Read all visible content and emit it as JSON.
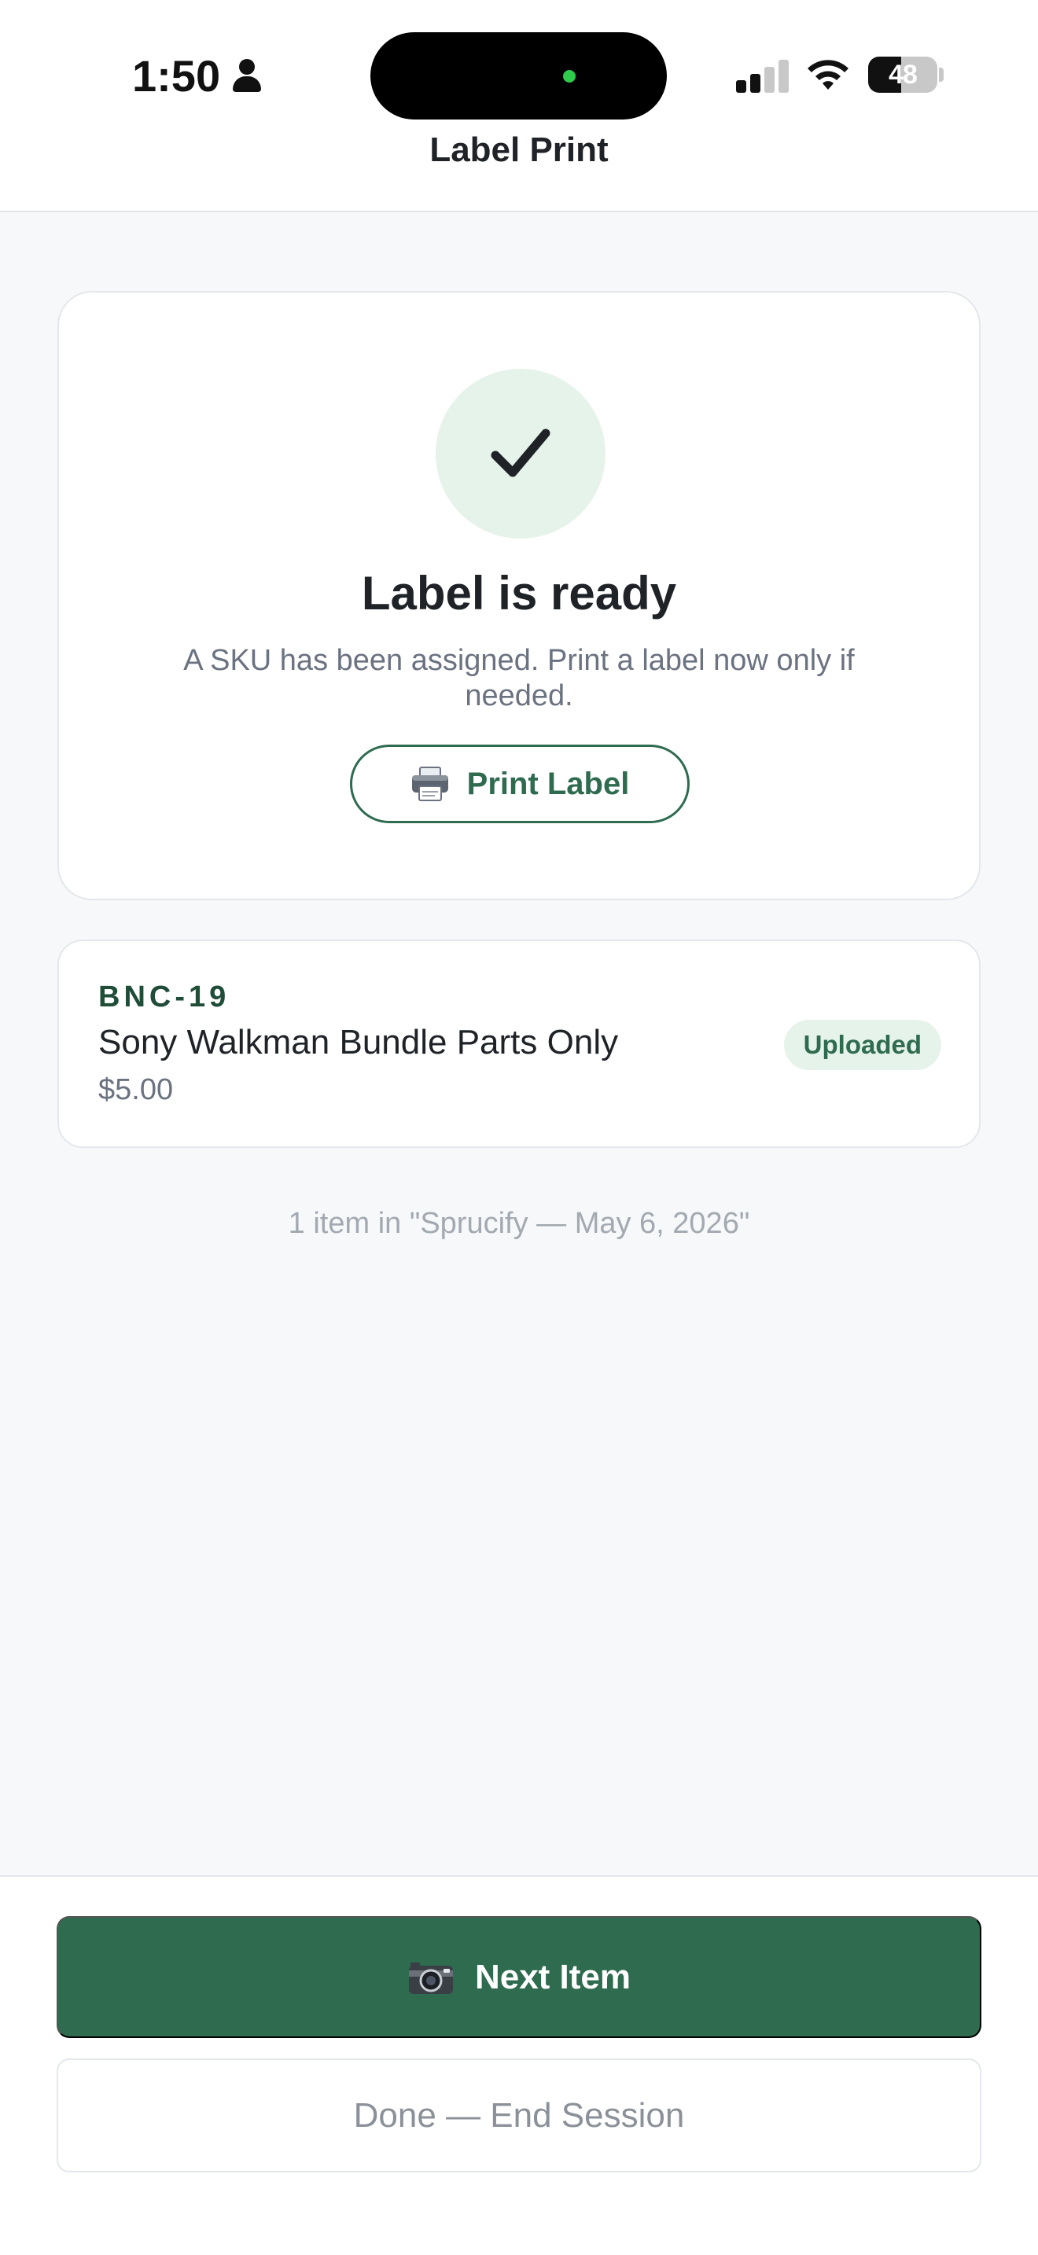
{
  "status_bar": {
    "time": "1:50",
    "battery": "48",
    "battery_level": 0.48
  },
  "header": {
    "title": "Label Print"
  },
  "ready_card": {
    "title": "Label is ready",
    "subtitle": "A SKU has been assigned. Print a label now only if needed.",
    "print_button_label": "Print Label"
  },
  "item": {
    "sku": "BNC-19",
    "name": "Sony Walkman Bundle Parts Only",
    "price": "$5.00",
    "status": "Uploaded"
  },
  "session_summary": "1 item in \"Sprucify — May 6, 2026\"",
  "actions": {
    "next_label": "Next Item",
    "done_label": "Done — End Session"
  },
  "colors": {
    "accent": "#2e6b4f",
    "success_bg": "#e6f3ea",
    "sku_text": "#1f4d38"
  }
}
